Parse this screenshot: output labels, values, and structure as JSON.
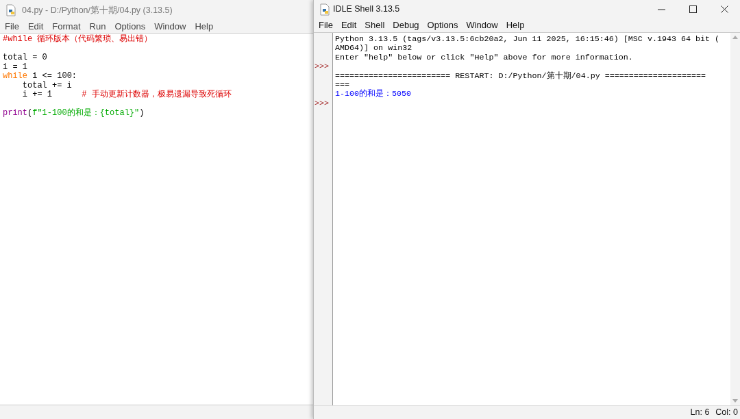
{
  "editor": {
    "title": "04.py - D:/Python/第十期/04.py (3.13.5)",
    "menu": [
      "File",
      "Edit",
      "Format",
      "Run",
      "Options",
      "Window",
      "Help"
    ],
    "lines": [
      {
        "kind": "code",
        "tokens": [
          {
            "kind": "comment",
            "text": "#while 循环版本（代码繁琐、易出错）"
          }
        ]
      },
      {
        "kind": "blank"
      },
      {
        "kind": "code",
        "tokens": [
          {
            "kind": "plain",
            "text": "total = 0"
          }
        ]
      },
      {
        "kind": "code",
        "tokens": [
          {
            "kind": "plain",
            "text": "i = 1"
          }
        ]
      },
      {
        "kind": "code",
        "tokens": [
          {
            "kind": "keyword",
            "text": "while"
          },
          {
            "kind": "plain",
            "text": " i <= 100:"
          }
        ]
      },
      {
        "kind": "code",
        "tokens": [
          {
            "kind": "plain",
            "text": "    total += i"
          }
        ]
      },
      {
        "kind": "code",
        "tokens": [
          {
            "kind": "plain",
            "text": "    i += 1      "
          },
          {
            "kind": "comment",
            "text": "# 手动更新计数器，极易遗漏导致死循环"
          }
        ]
      },
      {
        "kind": "blank"
      },
      {
        "kind": "code",
        "tokens": [
          {
            "kind": "builtin",
            "text": "print"
          },
          {
            "kind": "plain",
            "text": "("
          },
          {
            "kind": "string",
            "text": "f\"1-100的和是：{total}\""
          },
          {
            "kind": "plain",
            "text": ")"
          }
        ]
      }
    ]
  },
  "shell": {
    "title": "IDLE Shell 3.13.5",
    "menu": [
      "File",
      "Edit",
      "Shell",
      "Debug",
      "Options",
      "Window",
      "Help"
    ],
    "lines": [
      {
        "kind": "plain",
        "text": "Python 3.13.5 (tags/v3.13.5:6cb20a2, Jun 11 2025, 16:15:46) [MSC v.1943 64 bit ("
      },
      {
        "kind": "plain",
        "text": "AMD64)] on win32"
      },
      {
        "kind": "plain",
        "text": "Enter \"help\" below or click \"Help\" above for more information."
      },
      {
        "kind": "prompt",
        "text": ">>>"
      },
      {
        "kind": "plain",
        "text": "======================== RESTART: D:/Python/第十期/04.py ====================="
      },
      {
        "kind": "plain",
        "text": "==="
      },
      {
        "kind": "output",
        "text": "1-100的和是：5050"
      },
      {
        "kind": "prompt",
        "text": ">>>"
      }
    ],
    "status": {
      "line": "Ln: 6",
      "col": "Col: 0"
    }
  }
}
